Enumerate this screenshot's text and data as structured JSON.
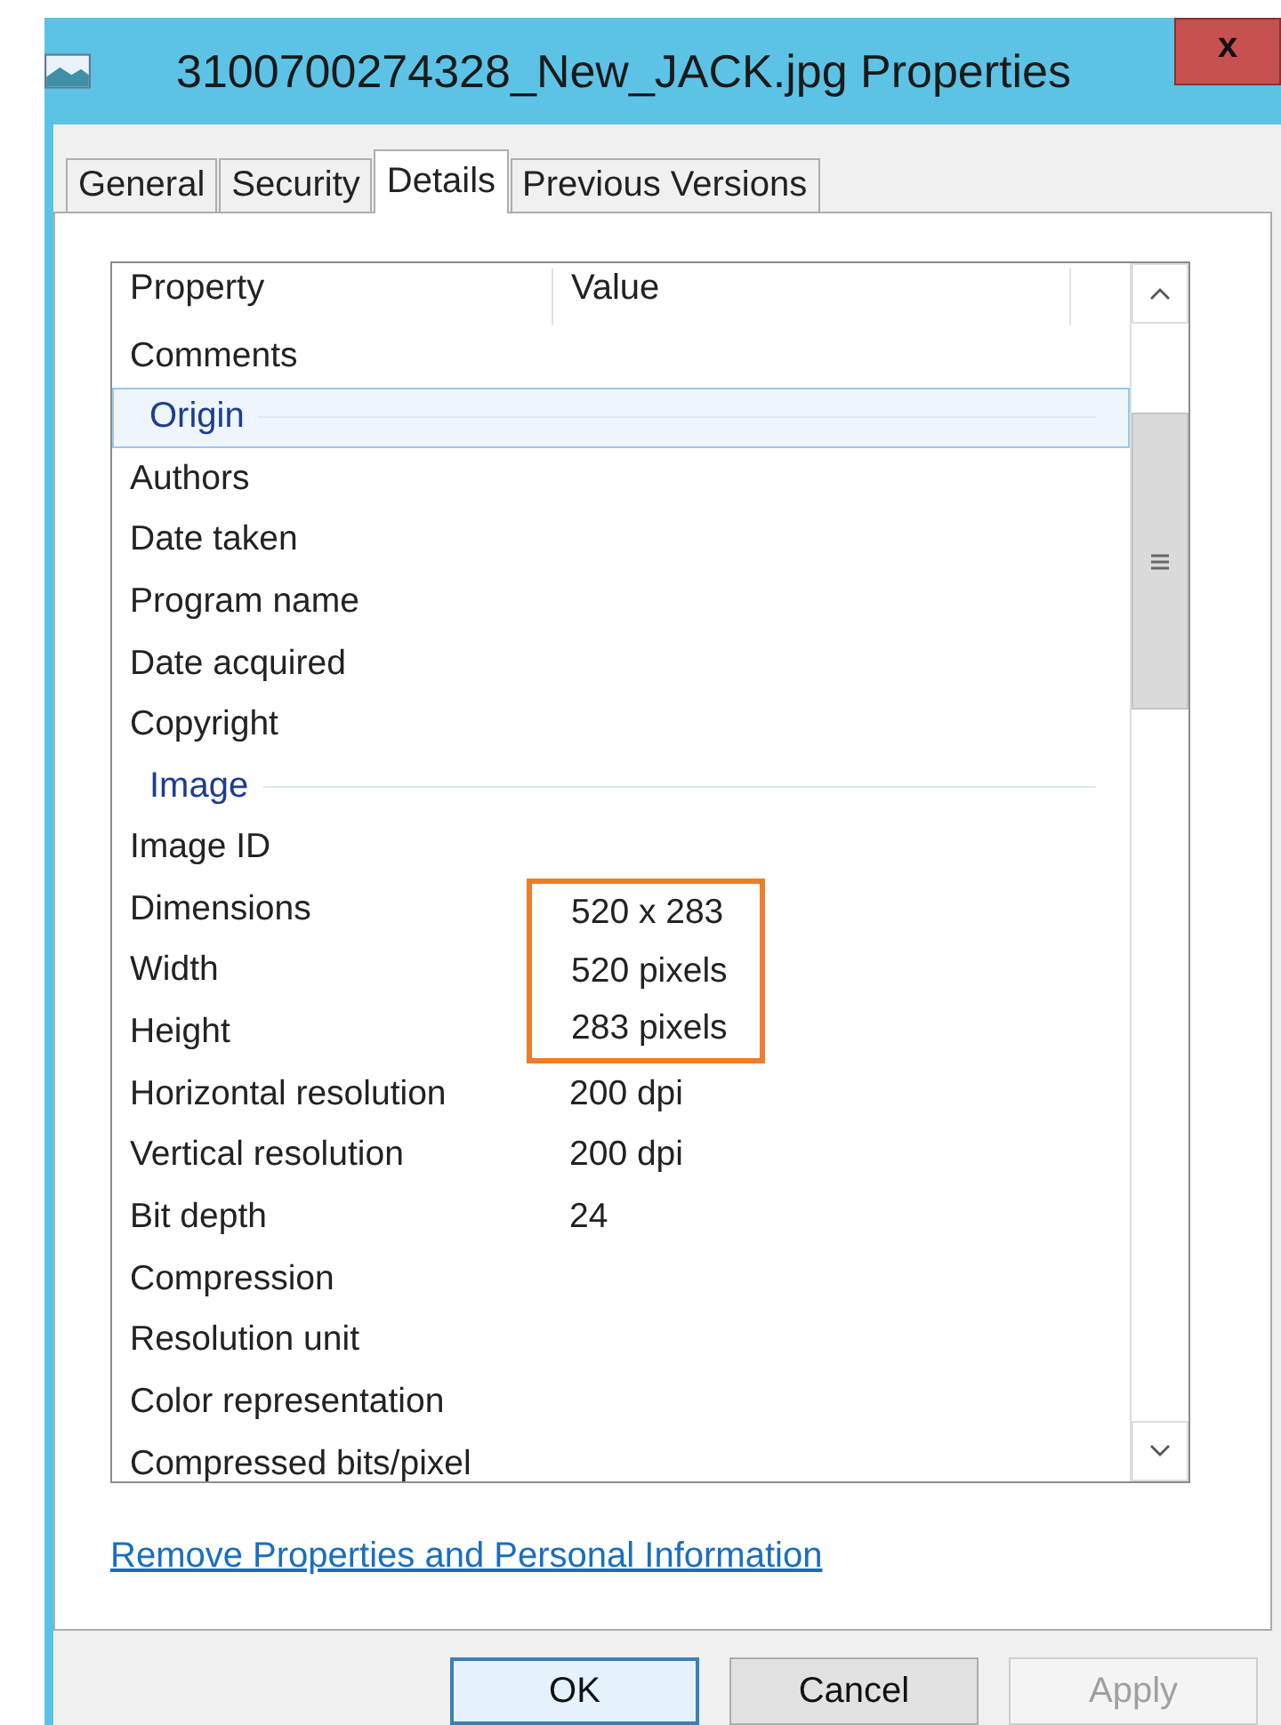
{
  "window": {
    "title": "3100700274328_New_JACK.jpg Properties",
    "close": "x"
  },
  "tabs": [
    {
      "label": "General",
      "selected": false
    },
    {
      "label": "Security",
      "selected": false
    },
    {
      "label": "Details",
      "selected": true
    },
    {
      "label": "Previous Versions",
      "selected": false
    }
  ],
  "table": {
    "columns": [
      "Property",
      "Value"
    ],
    "rows": [
      {
        "kind": "property",
        "name": "Comments",
        "value": "",
        "highlighted": false
      },
      {
        "kind": "group",
        "name": "Origin",
        "selected": true
      },
      {
        "kind": "property",
        "name": "Authors",
        "value": "",
        "highlighted": false
      },
      {
        "kind": "property",
        "name": "Date taken",
        "value": "",
        "highlighted": false
      },
      {
        "kind": "property",
        "name": "Program name",
        "value": "",
        "highlighted": false
      },
      {
        "kind": "property",
        "name": "Date acquired",
        "value": "",
        "highlighted": false
      },
      {
        "kind": "property",
        "name": "Copyright",
        "value": "",
        "highlighted": false
      },
      {
        "kind": "group",
        "name": "Image",
        "selected": false
      },
      {
        "kind": "property",
        "name": "Image ID",
        "value": "",
        "highlighted": false
      },
      {
        "kind": "property",
        "name": "Dimensions",
        "value": "520 x 283",
        "highlighted": true
      },
      {
        "kind": "property",
        "name": "Width",
        "value": "520 pixels",
        "highlighted": true
      },
      {
        "kind": "property",
        "name": "Height",
        "value": "283 pixels",
        "highlighted": true
      },
      {
        "kind": "property",
        "name": "Horizontal resolution",
        "value": "200 dpi",
        "highlighted": false
      },
      {
        "kind": "property",
        "name": "Vertical resolution",
        "value": "200 dpi",
        "highlighted": false
      },
      {
        "kind": "property",
        "name": "Bit depth",
        "value": "24",
        "highlighted": false
      },
      {
        "kind": "property",
        "name": "Compression",
        "value": "",
        "highlighted": false
      },
      {
        "kind": "property",
        "name": "Resolution unit",
        "value": "",
        "highlighted": false
      },
      {
        "kind": "property",
        "name": "Color representation",
        "value": "",
        "highlighted": false
      },
      {
        "kind": "property",
        "name": "Compressed bits/pixel",
        "value": "",
        "highlighted": false
      }
    ]
  },
  "link": "Remove Properties and Personal Information",
  "buttons": [
    {
      "label": "OK",
      "disabled": false,
      "default": true
    },
    {
      "label": "Cancel",
      "disabled": false,
      "default": false
    },
    {
      "label": "Apply",
      "disabled": true,
      "default": false
    }
  ]
}
